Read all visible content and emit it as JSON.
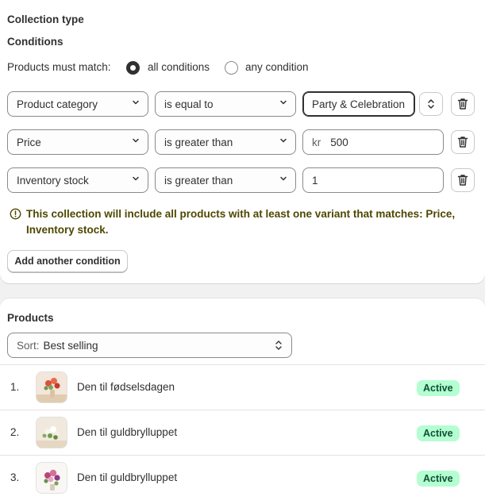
{
  "header": {
    "collection_type": "Collection type",
    "conditions_title": "Conditions"
  },
  "match": {
    "label": "Products must match:",
    "options": [
      "all conditions",
      "any condition"
    ],
    "selected": "all conditions"
  },
  "conditions": [
    {
      "field": "Product category",
      "operator": "is equal to",
      "value": "Party & Celebration",
      "prefix": ""
    },
    {
      "field": "Price",
      "operator": "is greater than",
      "value": "500",
      "prefix": "kr"
    },
    {
      "field": "Inventory stock",
      "operator": "is greater than",
      "value": "1",
      "prefix": ""
    }
  ],
  "warning": {
    "line1": "This collection will include all products with at least one variant that matches: Price,",
    "line2": "Inventory stock."
  },
  "add_condition_label": "Add another condition",
  "products": {
    "title": "Products",
    "sort_label": "Sort:",
    "sort_value": "Best selling",
    "items": [
      {
        "index": "1.",
        "name": "Den til fødselsdagen",
        "status": "Active"
      },
      {
        "index": "2.",
        "name": "Den til guldbrylluppet",
        "status": "Active"
      },
      {
        "index": "3.",
        "name": "Den til guldbrylluppet",
        "status": "Active"
      }
    ]
  },
  "colors": {
    "active_badge_bg": "#b4fed2",
    "warning_text": "#4f4700"
  }
}
